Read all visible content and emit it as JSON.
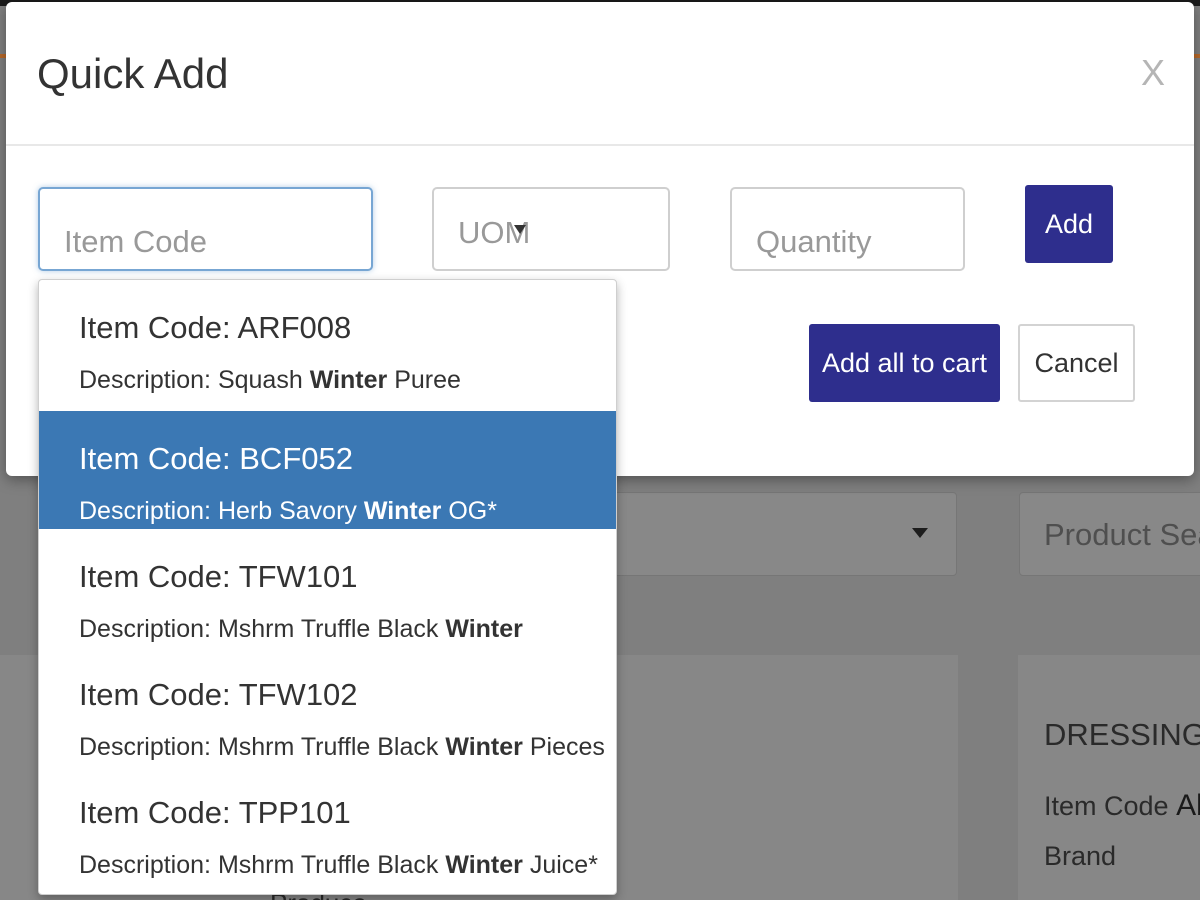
{
  "modal": {
    "title": "Quick Add",
    "close_label": "X",
    "item_code_placeholder": "Item Code",
    "uom_placeholder": "UOM",
    "quantity_placeholder": "Quantity",
    "add_label": "Add",
    "add_all_label": "Add all to cart",
    "cancel_label": "Cancel"
  },
  "dropdown": {
    "code_prefix": "Item Code: ",
    "desc_prefix": "Description: ",
    "highlight_term": "Winter",
    "selected_index": 1,
    "items": [
      {
        "code": "ARF008",
        "desc_before": "Squash ",
        "desc_match": "Winter",
        "desc_after": " Puree"
      },
      {
        "code": "BCF052",
        "desc_before": "Herb Savory ",
        "desc_match": "Winter",
        "desc_after": " OG*"
      },
      {
        "code": "TFW101",
        "desc_before": "Mshrm Truffle Black ",
        "desc_match": "Winter",
        "desc_after": ""
      },
      {
        "code": "TFW102",
        "desc_before": "Mshrm Truffle Black ",
        "desc_match": "Winter",
        "desc_after": " Pieces"
      },
      {
        "code": "TPP101",
        "desc_before": "Mshrm Truffle Black ",
        "desc_match": "Winter",
        "desc_after": " Juice*"
      }
    ]
  },
  "background": {
    "search_placeholder": "Product Search",
    "product_title": "DRESSING",
    "item_code_label": "Item Code",
    "item_code_value": "Ab",
    "brand_label": "Brand",
    "category_value": "Produce"
  },
  "colors": {
    "primary": "#2e2e8d",
    "highlight": "#3b78b4",
    "overlay": "#7f7f7f"
  }
}
